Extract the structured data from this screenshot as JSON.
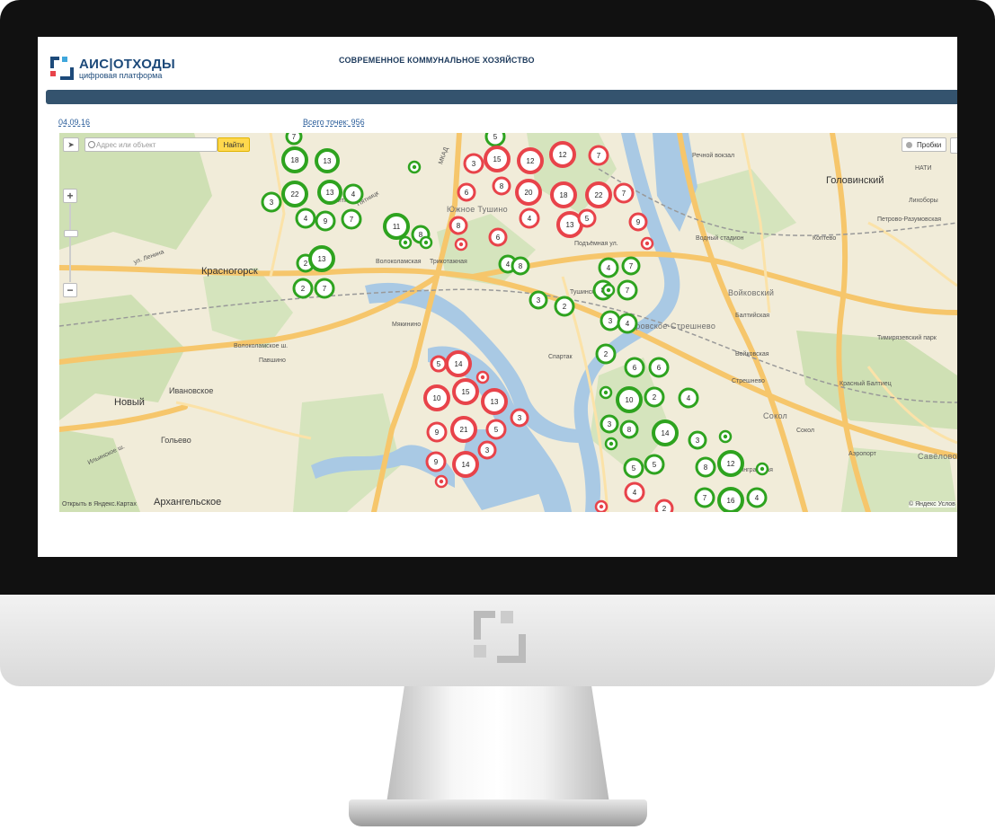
{
  "header": {
    "logo_main": "АИС|ОТХОДЫ",
    "logo_sub": "цифровая платформа",
    "title": "СОВРЕМЕННОЕ КОММУНАЛЬНОЕ ХОЗЯЙСТВО"
  },
  "toolbar": {
    "date": "04.09.16",
    "points_total": "Всего точек: 956"
  },
  "map": {
    "search_placeholder": "Адрес или объект",
    "find_label": "Найти",
    "traffic_label": "Пробки",
    "open_yandex": "Открыть в Яндекс.Картах",
    "copyright": "© Яндекс Услов",
    "zoom_in": "+",
    "zoom_out": "−",
    "labels": {
      "krasnogorsk": "Красногорск",
      "golovinsky": "Головинский",
      "voykovsky": "Войковский",
      "sokol": "Сокол",
      "savyolovo": "Савёлово",
      "streshnevo": "Покровское-Стрешнево",
      "novy": "Новый",
      "golyovo": "Гольево",
      "arkhangelskoe": "Архангельское",
      "ivanovskoe": "Ивановское",
      "yuzhnoe_tushino": "Южное Тушино",
      "myakinino": "Мякинино",
      "spartak": "Спартак",
      "volokolamskaya": "Волоколамская",
      "baltiyskaya": "Балтийская",
      "koptevo": "Коптево",
      "likhobory": "Лихоборы",
      "vodny_stadion": "Водный стадион",
      "rechnoy_vokzal": "Речной вокзал",
      "voykovskaya": "Войковская",
      "streshnevo_st": "Стрешнево",
      "aeroport": "Аэропорт",
      "sokol_st": "Сокол",
      "mkad": "МКАД",
      "volokolamskoe_sh": "Волоколамское ш.",
      "ul_lenina": "ул. Ленина",
      "ilinskoe_sh": "Ильинское ш.",
      "pyatnitskoe": "Пятницк",
      "mitino": "Митино",
      "podzhny": "Подъёмная ул.",
      "tushinskaya": "Тушинская",
      "nati": "НАТИ",
      "trikotazhnaya": "Трикотажная",
      "pavshino": "Павшино",
      "krasny_baltiets": "Красный Балтиец",
      "leningradskaya": "Ленинградская",
      "timiryazevsky_park": "Тимирязевский парк",
      "petrovsko": "Петрово-Разумовская"
    },
    "clusters": [
      {
        "n": "7",
        "c": "green"
      },
      {
        "n": "18",
        "c": "green"
      },
      {
        "n": "13",
        "c": "green"
      },
      {
        "n": "3",
        "c": "green"
      },
      {
        "n": "22",
        "c": "green"
      },
      {
        "n": "13",
        "c": "green"
      },
      {
        "n": "4",
        "c": "green"
      },
      {
        "n": "4",
        "c": "green"
      },
      {
        "n": "9",
        "c": "green"
      },
      {
        "n": "7",
        "c": "green"
      },
      {
        "n": "11",
        "c": "green"
      },
      {
        "n": "8",
        "c": "green"
      },
      {
        "n": "2",
        "c": "green"
      },
      {
        "n": "13",
        "c": "green"
      },
      {
        "n": "2",
        "c": "green"
      },
      {
        "n": "7",
        "c": "green"
      },
      {
        "n": "5",
        "c": "green"
      },
      {
        "n": "3",
        "c": "red"
      },
      {
        "n": "15",
        "c": "red"
      },
      {
        "n": "12",
        "c": "red"
      },
      {
        "n": "12",
        "c": "red"
      },
      {
        "n": "7",
        "c": "red"
      },
      {
        "n": "6",
        "c": "red"
      },
      {
        "n": "8",
        "c": "red"
      },
      {
        "n": "20",
        "c": "red"
      },
      {
        "n": "18",
        "c": "red"
      },
      {
        "n": "22",
        "c": "red"
      },
      {
        "n": "7",
        "c": "red"
      },
      {
        "n": "8",
        "c": "red"
      },
      {
        "n": "4",
        "c": "red"
      },
      {
        "n": "13",
        "c": "red"
      },
      {
        "n": "5",
        "c": "red"
      },
      {
        "n": "9",
        "c": "red"
      },
      {
        "n": "6",
        "c": "red"
      },
      {
        "n": "4",
        "c": "green"
      },
      {
        "n": "8",
        "c": "green"
      },
      {
        "n": "4",
        "c": "green"
      },
      {
        "n": "7",
        "c": "green"
      },
      {
        "n": "8",
        "c": "green"
      },
      {
        "n": "7",
        "c": "green"
      },
      {
        "n": "3",
        "c": "green"
      },
      {
        "n": "2",
        "c": "green"
      },
      {
        "n": "3",
        "c": "green"
      },
      {
        "n": "4",
        "c": "green"
      },
      {
        "n": "2",
        "c": "green"
      },
      {
        "n": "6",
        "c": "green"
      },
      {
        "n": "6",
        "c": "green"
      },
      {
        "n": "5",
        "c": "red"
      },
      {
        "n": "14",
        "c": "red"
      },
      {
        "n": "10",
        "c": "red"
      },
      {
        "n": "15",
        "c": "red"
      },
      {
        "n": "13",
        "c": "red"
      },
      {
        "n": "10",
        "c": "green"
      },
      {
        "n": "2",
        "c": "green"
      },
      {
        "n": "4",
        "c": "green"
      },
      {
        "n": "9",
        "c": "red"
      },
      {
        "n": "21",
        "c": "red"
      },
      {
        "n": "5",
        "c": "red"
      },
      {
        "n": "3",
        "c": "red"
      },
      {
        "n": "3",
        "c": "green"
      },
      {
        "n": "8",
        "c": "green"
      },
      {
        "n": "14",
        "c": "green"
      },
      {
        "n": "3",
        "c": "green"
      },
      {
        "n": "3",
        "c": "red"
      },
      {
        "n": "9",
        "c": "red"
      },
      {
        "n": "14",
        "c": "red"
      },
      {
        "n": "5",
        "c": "green"
      },
      {
        "n": "5",
        "c": "green"
      },
      {
        "n": "8",
        "c": "green"
      },
      {
        "n": "12",
        "c": "green"
      },
      {
        "n": "4",
        "c": "red"
      },
      {
        "n": "2",
        "c": "red"
      },
      {
        "n": "7",
        "c": "green"
      },
      {
        "n": "16",
        "c": "green"
      },
      {
        "n": "4",
        "c": "green"
      }
    ]
  },
  "colors": {
    "green": "#2ea31f",
    "red": "#e8434a",
    "nav": "#34536e",
    "brand": "#1d4a7a",
    "find": "#ffd84d"
  }
}
